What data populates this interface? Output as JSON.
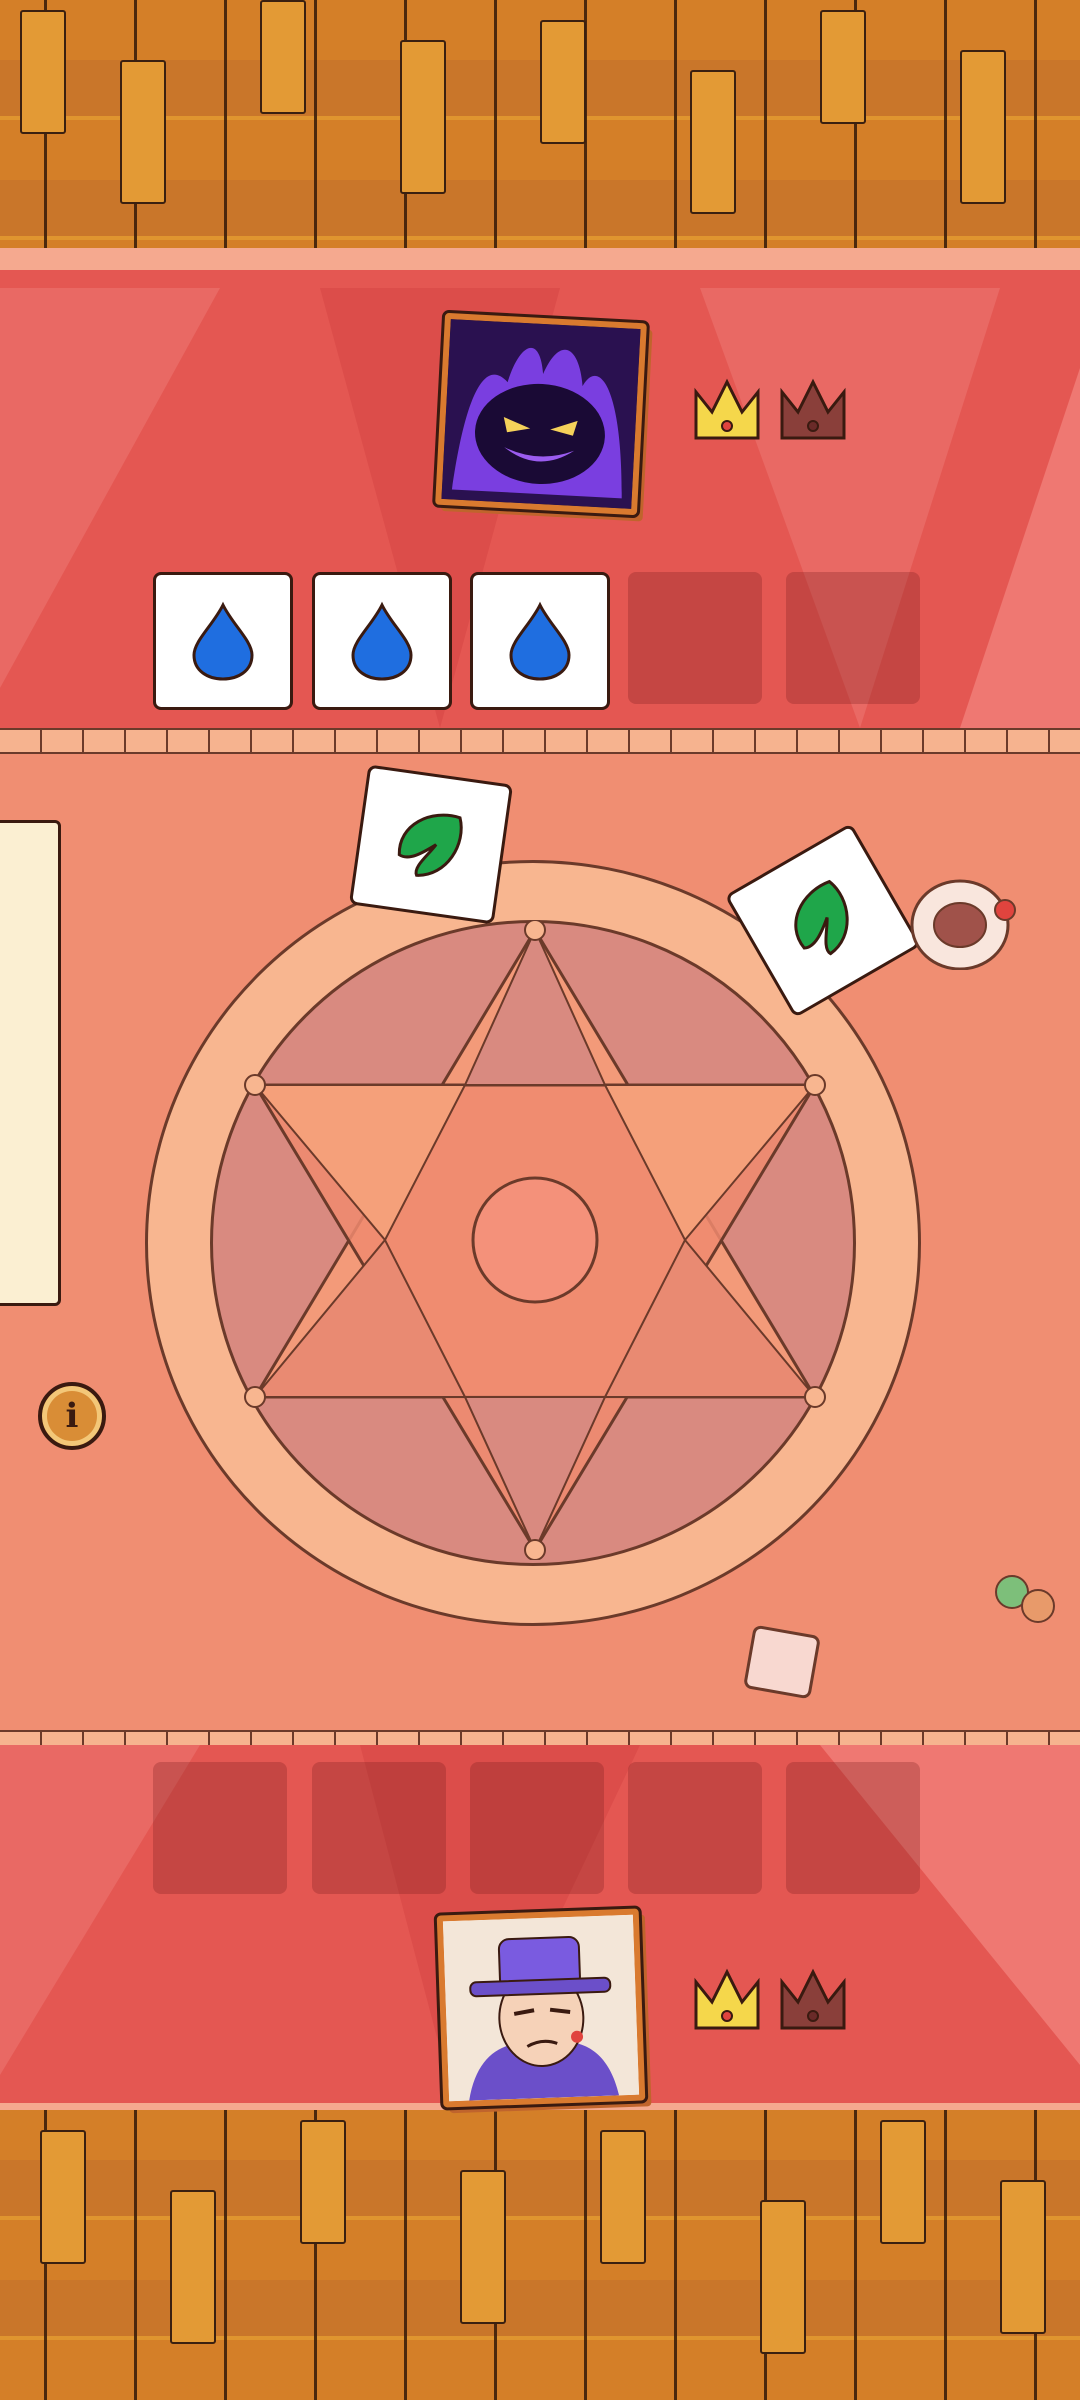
{
  "opponent": {
    "portrait_icon": "shadow-monster",
    "crowns": [
      {
        "state": "won",
        "color": "#f5d74b"
      },
      {
        "state": "empty",
        "color": "#8a3f3a"
      }
    ],
    "hand": [
      {
        "element": "water"
      },
      {
        "element": "water"
      },
      {
        "element": "water"
      },
      {
        "element": null
      },
      {
        "element": null
      }
    ]
  },
  "player": {
    "portrait_icon": "purple-hat-wizard",
    "crowns": [
      {
        "state": "won",
        "color": "#f5d74b"
      },
      {
        "state": "empty",
        "color": "#8a3f3a"
      }
    ],
    "hand": [
      {
        "element": null
      },
      {
        "element": null
      },
      {
        "element": null
      },
      {
        "element": null
      },
      {
        "element": null
      }
    ]
  },
  "board": {
    "played_cards": [
      {
        "element": "leaf",
        "owner": "opponent"
      },
      {
        "element": "leaf",
        "owner": "opponent"
      }
    ]
  },
  "info_button": {
    "label": "i"
  },
  "colors": {
    "water": "#1f6ee0",
    "leaf": "#1fa64a",
    "band": "#e45752",
    "arena": "#f08e72",
    "wood": "#d8882e"
  }
}
